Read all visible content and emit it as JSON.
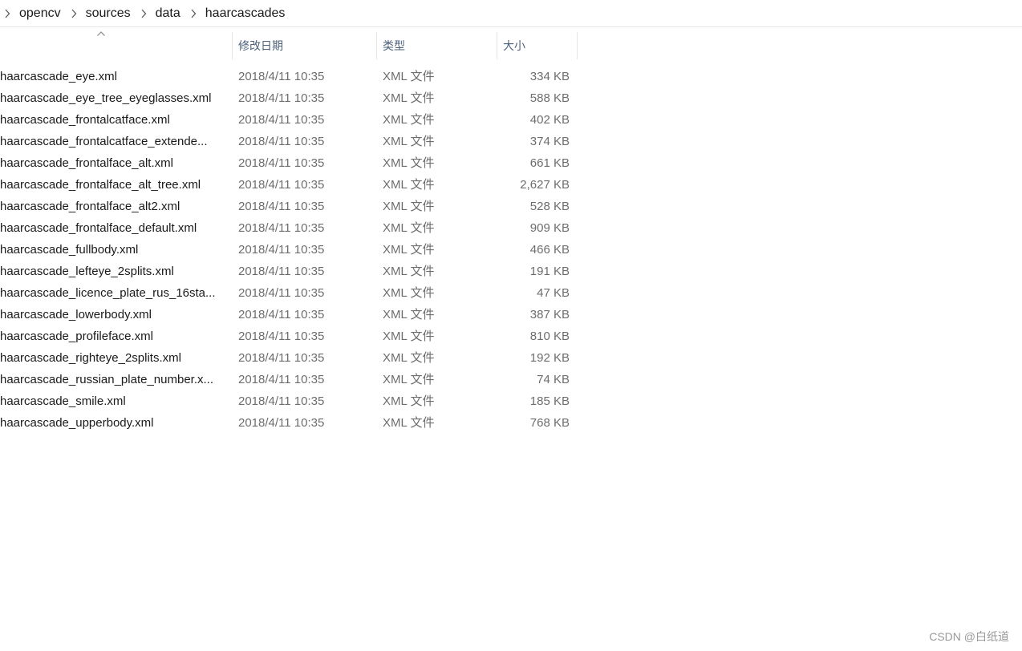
{
  "breadcrumb": {
    "items": [
      "opencv",
      "sources",
      "data",
      "haarcascades"
    ]
  },
  "columns": {
    "name": "",
    "date": "修改日期",
    "type": "类型",
    "size": "大小"
  },
  "files": [
    {
      "name": "haarcascade_eye.xml",
      "date": "2018/4/11 10:35",
      "type": "XML 文件",
      "size": "334 KB"
    },
    {
      "name": "haarcascade_eye_tree_eyeglasses.xml",
      "date": "2018/4/11 10:35",
      "type": "XML 文件",
      "size": "588 KB"
    },
    {
      "name": "haarcascade_frontalcatface.xml",
      "date": "2018/4/11 10:35",
      "type": "XML 文件",
      "size": "402 KB"
    },
    {
      "name": "haarcascade_frontalcatface_extende...",
      "date": "2018/4/11 10:35",
      "type": "XML 文件",
      "size": "374 KB"
    },
    {
      "name": "haarcascade_frontalface_alt.xml",
      "date": "2018/4/11 10:35",
      "type": "XML 文件",
      "size": "661 KB"
    },
    {
      "name": "haarcascade_frontalface_alt_tree.xml",
      "date": "2018/4/11 10:35",
      "type": "XML 文件",
      "size": "2,627 KB"
    },
    {
      "name": "haarcascade_frontalface_alt2.xml",
      "date": "2018/4/11 10:35",
      "type": "XML 文件",
      "size": "528 KB"
    },
    {
      "name": "haarcascade_frontalface_default.xml",
      "date": "2018/4/11 10:35",
      "type": "XML 文件",
      "size": "909 KB"
    },
    {
      "name": "haarcascade_fullbody.xml",
      "date": "2018/4/11 10:35",
      "type": "XML 文件",
      "size": "466 KB"
    },
    {
      "name": "haarcascade_lefteye_2splits.xml",
      "date": "2018/4/11 10:35",
      "type": "XML 文件",
      "size": "191 KB"
    },
    {
      "name": "haarcascade_licence_plate_rus_16sta...",
      "date": "2018/4/11 10:35",
      "type": "XML 文件",
      "size": "47 KB"
    },
    {
      "name": "haarcascade_lowerbody.xml",
      "date": "2018/4/11 10:35",
      "type": "XML 文件",
      "size": "387 KB"
    },
    {
      "name": "haarcascade_profileface.xml",
      "date": "2018/4/11 10:35",
      "type": "XML 文件",
      "size": "810 KB"
    },
    {
      "name": "haarcascade_righteye_2splits.xml",
      "date": "2018/4/11 10:35",
      "type": "XML 文件",
      "size": "192 KB"
    },
    {
      "name": "haarcascade_russian_plate_number.x...",
      "date": "2018/4/11 10:35",
      "type": "XML 文件",
      "size": "74 KB"
    },
    {
      "name": "haarcascade_smile.xml",
      "date": "2018/4/11 10:35",
      "type": "XML 文件",
      "size": "185 KB"
    },
    {
      "name": "haarcascade_upperbody.xml",
      "date": "2018/4/11 10:35",
      "type": "XML 文件",
      "size": "768 KB"
    }
  ],
  "watermark": "CSDN @白纸道",
  "icons": {
    "breadcrumb_separator": "chevron-right-icon",
    "sort_indicator": "chevron-up-icon"
  },
  "colors": {
    "header_text": "#4c607a",
    "secondary_text": "#6d6d6d",
    "primary_text": "#1a1a1a"
  }
}
